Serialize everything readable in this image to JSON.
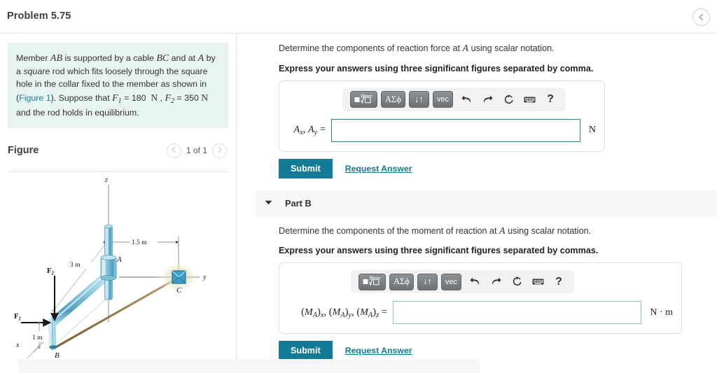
{
  "header": {
    "problem_title": "Problem 5.75",
    "back_icon": "chevron-left-icon"
  },
  "problem": {
    "statement_parts": [
      "Member ",
      "AB",
      " is supported by a cable ",
      "BC",
      " and at ",
      "A",
      " by a ",
      "square",
      " rod which fits loosely through the square hole in the collar fixed to the member as shown in (",
      "Figure 1",
      ").",
      " Suppose that ",
      "F",
      "1",
      " = 180  N , ",
      "F",
      "2",
      " = 350  N and the rod holds in equilibrium."
    ],
    "figure_link_text": "Figure 1",
    "F1_value": "180",
    "F2_value": "350",
    "force_unit": "N",
    "background_color": "#e7f4f2",
    "link_color": "#1b7fa3"
  },
  "figure_panel": {
    "title": "Figure",
    "counter": "1 of 1",
    "prev_icon": "chevron-left-icon",
    "next_icon": "chevron-right-icon",
    "labels": {
      "z_axis": "z",
      "y_axis": "y",
      "x_axis": "x",
      "point_A": "A",
      "point_B": "B",
      "point_C": "C",
      "force_1": "F",
      "force_1_sub": "1",
      "force_2": "F",
      "force_2_sub": "2",
      "dim_3m": "3 m",
      "dim_1_5m": "1.5 m",
      "dim_1m": "1 m"
    },
    "colors": {
      "member": "#79bdd6",
      "member_dark": "#3f8fad",
      "cable": "#a08a63",
      "highlight": "#e3e2c4"
    }
  },
  "part_a": {
    "question": "Determine the components of reaction force at A using scalar notation.",
    "question_pre": "Determine the components of reaction force at ",
    "question_var": "A",
    "question_post": " using scalar notation.",
    "instruction": "Express your answers using three significant figures separated by comma.",
    "answer_label_main": "A",
    "answer_label": "Ax, Ay =",
    "answer_value": "",
    "units": "N",
    "submit_label": "Submit",
    "request_answer_label": "Request Answer",
    "toolbar": {
      "buttons": [
        {
          "name": "template-math-button",
          "label": "■√□"
        },
        {
          "name": "greek-symbols-button",
          "label": "ΑΣϕ"
        },
        {
          "name": "arrows-button",
          "label": "↓↑"
        },
        {
          "name": "vector-button",
          "label": "vec"
        }
      ],
      "icons": [
        {
          "name": "undo-icon",
          "glyph": "↩"
        },
        {
          "name": "redo-icon",
          "glyph": "↪"
        },
        {
          "name": "reset-icon",
          "glyph": "↻"
        },
        {
          "name": "keyboard-icon",
          "glyph": "⌨"
        },
        {
          "name": "help-icon",
          "glyph": "?"
        }
      ]
    }
  },
  "part_b": {
    "header_label": "Part B",
    "caret_icon": "caret-down-icon",
    "question_pre": "Determine the components of the moment of reaction at ",
    "question_var": "A",
    "question_post": " using scalar notation.",
    "instruction": "Express your answers using three significant figures separated by commas.",
    "answer_label": "(MA)x, (MA)y, (MA)z =",
    "answer_value": "",
    "units": "N · m",
    "submit_label": "Submit",
    "request_answer_label": "Request Answer",
    "toolbar": {
      "buttons": [
        {
          "name": "template-math-button",
          "label": "■√□"
        },
        {
          "name": "greek-symbols-button",
          "label": "ΑΣϕ"
        },
        {
          "name": "arrows-button",
          "label": "↓↑"
        },
        {
          "name": "vector-button",
          "label": "vec"
        }
      ],
      "icons": [
        {
          "name": "undo-icon",
          "glyph": "↩"
        },
        {
          "name": "redo-icon",
          "glyph": "↪"
        },
        {
          "name": "reset-icon",
          "glyph": "↻"
        },
        {
          "name": "keyboard-icon",
          "glyph": "⌨"
        },
        {
          "name": "help-icon",
          "glyph": "?"
        }
      ]
    }
  },
  "theme": {
    "accent": "#137b96",
    "input_focus_border": "#2b7f97",
    "input_border": "#8cc2da",
    "panel_bg": "#f7f7f7"
  }
}
